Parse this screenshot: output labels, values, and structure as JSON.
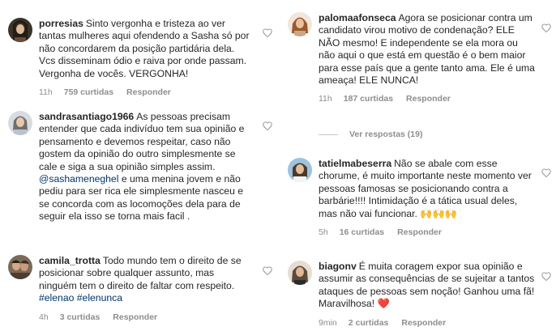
{
  "colors": {
    "text": "#262626",
    "muted": "#8e8e8e",
    "mention": "#003569",
    "heart_emoji": "#ed4956"
  },
  "left_column": [
    {
      "username": "porresias",
      "text": "Sinto vergonha e tristeza ao ver tantas mulheres aqui ofendendo a Sasha só por não concordarem da posição partidária dela.  Vcs disseminam ódio e raiva por onde passam. Vergonha de vocês. VERGONHA!",
      "time": "11h",
      "likes": "759 curtidas",
      "reply": "Responder",
      "avatar_icon": "avatar-porresias"
    },
    {
      "username": "sandrasantiago1966",
      "text_before": "As pessoas precisam entender que cada indivíduo tem sua opinião e pensamento e devemos respeitar, caso não gostem da opinião do outro simplesmente se cale e siga a sua opinião simples assim.",
      "mention": "@sashameneghel",
      "text_after": "e uma menina jovem e não pediu para ser rica ele simplesmente nasceu e se concorda com as locomoções dela para de seguir ela isso se torna mais facil .",
      "avatar_icon": "avatar-sandrasantiago1966"
    },
    {
      "username": "camila_trotta",
      "text": "Todo mundo tem o direito de se posicionar sobre qualquer assunto, mas ninguém tem o direito de faltar com respeito.",
      "hashtags": "#elenao #elenunca",
      "time": "4h",
      "likes": "3 curtidas",
      "reply": "Responder",
      "avatar_icon": "avatar-camila-trotta"
    }
  ],
  "right_column": [
    {
      "username": "palomaafonseca",
      "text": "Agora se posicionar contra um candidato virou motivo de condenação? ELE NÃO mesmo! E independente se ela mora ou não aqui o que está em questão é o bem maior para esse país que a gente tanto ama. Ele é uma ameaça! ELE NUNCA!",
      "time": "11h",
      "likes": "187 curtidas",
      "reply": "Responder",
      "view_replies": "Ver respostas (19)",
      "avatar_icon": "avatar-palomaafonseca"
    },
    {
      "username": "tatielmabeserra",
      "text": "Não se abale com esse chorume, é muito importante neste momento ver pessoas famosas se posicionando contra a barbárie!!!! Intimidação é a tática usual deles, mas não vai funcionar.",
      "emoji": "🙌🙌🙌",
      "time": "5h",
      "likes": "16 curtidas",
      "reply": "Responder",
      "avatar_icon": "avatar-tatielmabeserra"
    },
    {
      "username": "biagonv",
      "text": "É muita coragem expor sua opinião e assumir as consequências de se sujeitar a tantos ataques de pessoas sem noção! Ganhou uma fã! Maravilhosa!",
      "emoji": "❤️",
      "time": "9min",
      "likes": "2 curtidas",
      "reply": "Responder",
      "avatar_icon": "avatar-biagonv"
    }
  ]
}
